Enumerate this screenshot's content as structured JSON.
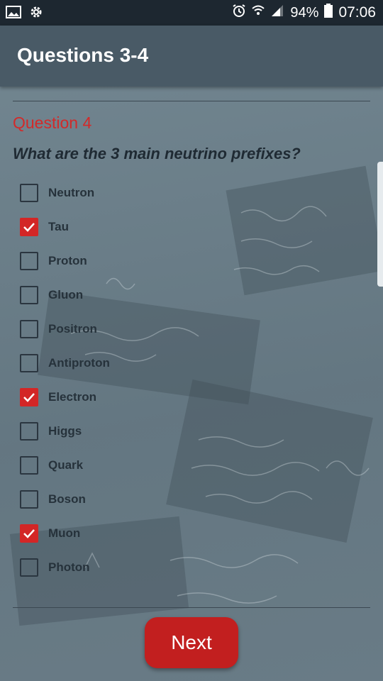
{
  "status_bar": {
    "left_icons": [
      "image-icon",
      "settings-icon"
    ],
    "right_icons": [
      "alarm-icon",
      "wifi-icon",
      "signal-icon",
      "battery-icon"
    ],
    "battery_percent": "94%",
    "time": "07:06"
  },
  "app_bar": {
    "title": "Questions 3-4"
  },
  "question": {
    "number_label": "Question 4",
    "text": "What are the 3 main neutrino prefixes?",
    "options": [
      {
        "label": "Neutron",
        "checked": false
      },
      {
        "label": "Tau",
        "checked": true
      },
      {
        "label": "Proton",
        "checked": false
      },
      {
        "label": "Gluon",
        "checked": false
      },
      {
        "label": "Positron",
        "checked": false
      },
      {
        "label": "Antiproton",
        "checked": false
      },
      {
        "label": "Electron",
        "checked": true
      },
      {
        "label": "Higgs",
        "checked": false
      },
      {
        "label": "Quark",
        "checked": false
      },
      {
        "label": "Boson",
        "checked": false
      },
      {
        "label": "Muon",
        "checked": true
      },
      {
        "label": "Photon",
        "checked": false
      }
    ]
  },
  "next_button": {
    "label": "Next"
  },
  "colors": {
    "accent": "#d32626",
    "app_bar": "#495a66",
    "status_bar": "#1d2730",
    "question_number": "#d22a2a"
  }
}
